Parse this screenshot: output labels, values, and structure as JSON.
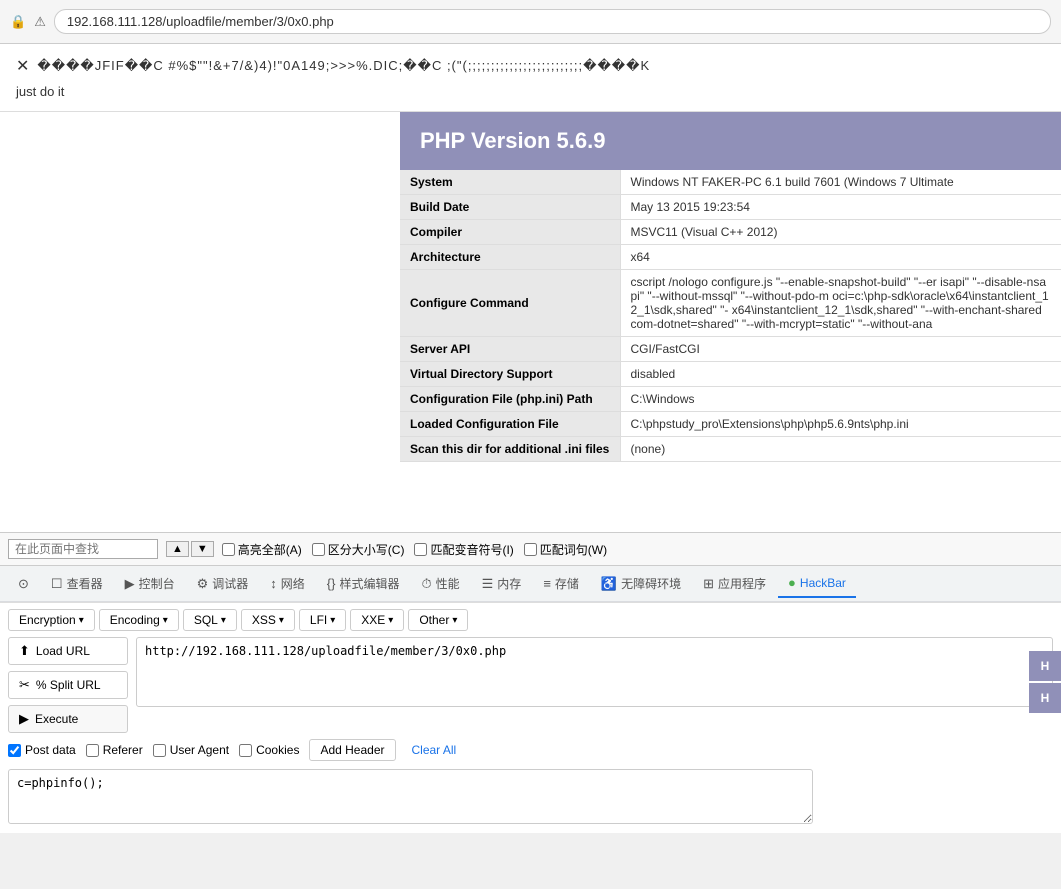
{
  "browser": {
    "url_prefix": "192.168.111.128",
    "url_path": "/uploadfile/member/3/0x0.php",
    "full_url": "192.168.111.128/uploadfile/member/3/0x0.php"
  },
  "page": {
    "garbled_text": "����JFIF��C   #%$\"\"!&+7/&)4)!\"0A149;>>>%.DIC;��C  ;(\"(;;;;;;;;;;;;;;;;;;;;;;;;;����K",
    "subtitle": "just do it"
  },
  "php_info": {
    "title": "PHP Version 5.6.9",
    "rows": [
      {
        "key": "System",
        "value": "Windows NT FAKER-PC 6.1 build 7601 (Windows 7 Ultimate"
      },
      {
        "key": "Build Date",
        "value": "May 13 2015 19:23:54"
      },
      {
        "key": "Compiler",
        "value": "MSVC11 (Visual C++ 2012)"
      },
      {
        "key": "Architecture",
        "value": "x64"
      },
      {
        "key": "Configure Command",
        "value": "cscript /nologo configure.js \"--enable-snapshot-build\" \"--er isapi\" \"--disable-nsapi\" \"--without-mssql\" \"--without-pdo-m oci=c:\\php-sdk\\oracle\\x64\\instantclient_12_1\\sdk,shared\" \"- x64\\instantclient_12_1\\sdk,shared\" \"--with-enchant-shared com-dotnet=shared\" \"--with-mcrypt=static\" \"--without-ana"
      },
      {
        "key": "Server API",
        "value": "CGI/FastCGI"
      },
      {
        "key": "Virtual Directory Support",
        "value": "disabled"
      },
      {
        "key": "Configuration File (php.ini) Path",
        "value": "C:\\Windows"
      },
      {
        "key": "Loaded Configuration File",
        "value": "C:\\phpstudy_pro\\Extensions\\php\\php5.6.9nts\\php.ini"
      },
      {
        "key": "Scan this dir for additional .ini files",
        "value": "(none)"
      }
    ]
  },
  "find_bar": {
    "placeholder": "在此页面中查找",
    "options": {
      "highlight_all": "高亮全部(A)",
      "case_sensitive": "区分大小写(C)",
      "match_diacritics": "匹配变音符号(I)",
      "whole_words": "匹配词句(W)"
    }
  },
  "devtools": {
    "tabs": [
      {
        "id": "inspector",
        "icon": "☐",
        "label": "查看器"
      },
      {
        "id": "console",
        "icon": "▶",
        "label": "控制台"
      },
      {
        "id": "debugger",
        "icon": "⚙",
        "label": "调试器"
      },
      {
        "id": "network",
        "icon": "↕",
        "label": "网络"
      },
      {
        "id": "style-editor",
        "icon": "{}",
        "label": "样式编辑器"
      },
      {
        "id": "performance",
        "icon": "⏱",
        "label": "性能"
      },
      {
        "id": "memory",
        "icon": "☰",
        "label": "内存"
      },
      {
        "id": "storage",
        "icon": "≡",
        "label": "存储"
      },
      {
        "id": "accessibility",
        "icon": "♿",
        "label": "无障碍环境"
      },
      {
        "id": "app-manager",
        "icon": "⊞",
        "label": "应用程序"
      },
      {
        "id": "hackbar",
        "icon": "●",
        "label": "HackBar",
        "active": true
      }
    ]
  },
  "hackbar": {
    "menus": [
      {
        "id": "encryption",
        "label": "Encryption",
        "has_arrow": true
      },
      {
        "id": "encoding",
        "label": "Encoding",
        "has_arrow": true
      },
      {
        "id": "sql",
        "label": "SQL",
        "has_arrow": true
      },
      {
        "id": "xss",
        "label": "XSS",
        "has_arrow": true
      },
      {
        "id": "lfi",
        "label": "LFI",
        "has_arrow": true
      },
      {
        "id": "xxe",
        "label": "XXE",
        "has_arrow": true
      },
      {
        "id": "other",
        "label": "Other",
        "has_arrow": true
      }
    ],
    "buttons": {
      "load_url": "Load URL",
      "split_url": "% Split URL",
      "execute": "Execute"
    },
    "url_value": "http://192.168.111.128/uploadfile/member/3/0x0.php",
    "checkboxes": [
      {
        "id": "post-data",
        "label": "Post data",
        "checked": true
      },
      {
        "id": "referer",
        "label": "Referer",
        "checked": false
      },
      {
        "id": "user-agent",
        "label": "User Agent",
        "checked": false
      },
      {
        "id": "cookies",
        "label": "Cookies",
        "checked": false
      }
    ],
    "add_header_label": "Add Header",
    "clear_all_label": "Clear All",
    "body_value": "c=phpinfo();",
    "side_buttons": [
      "H",
      "H"
    ]
  }
}
